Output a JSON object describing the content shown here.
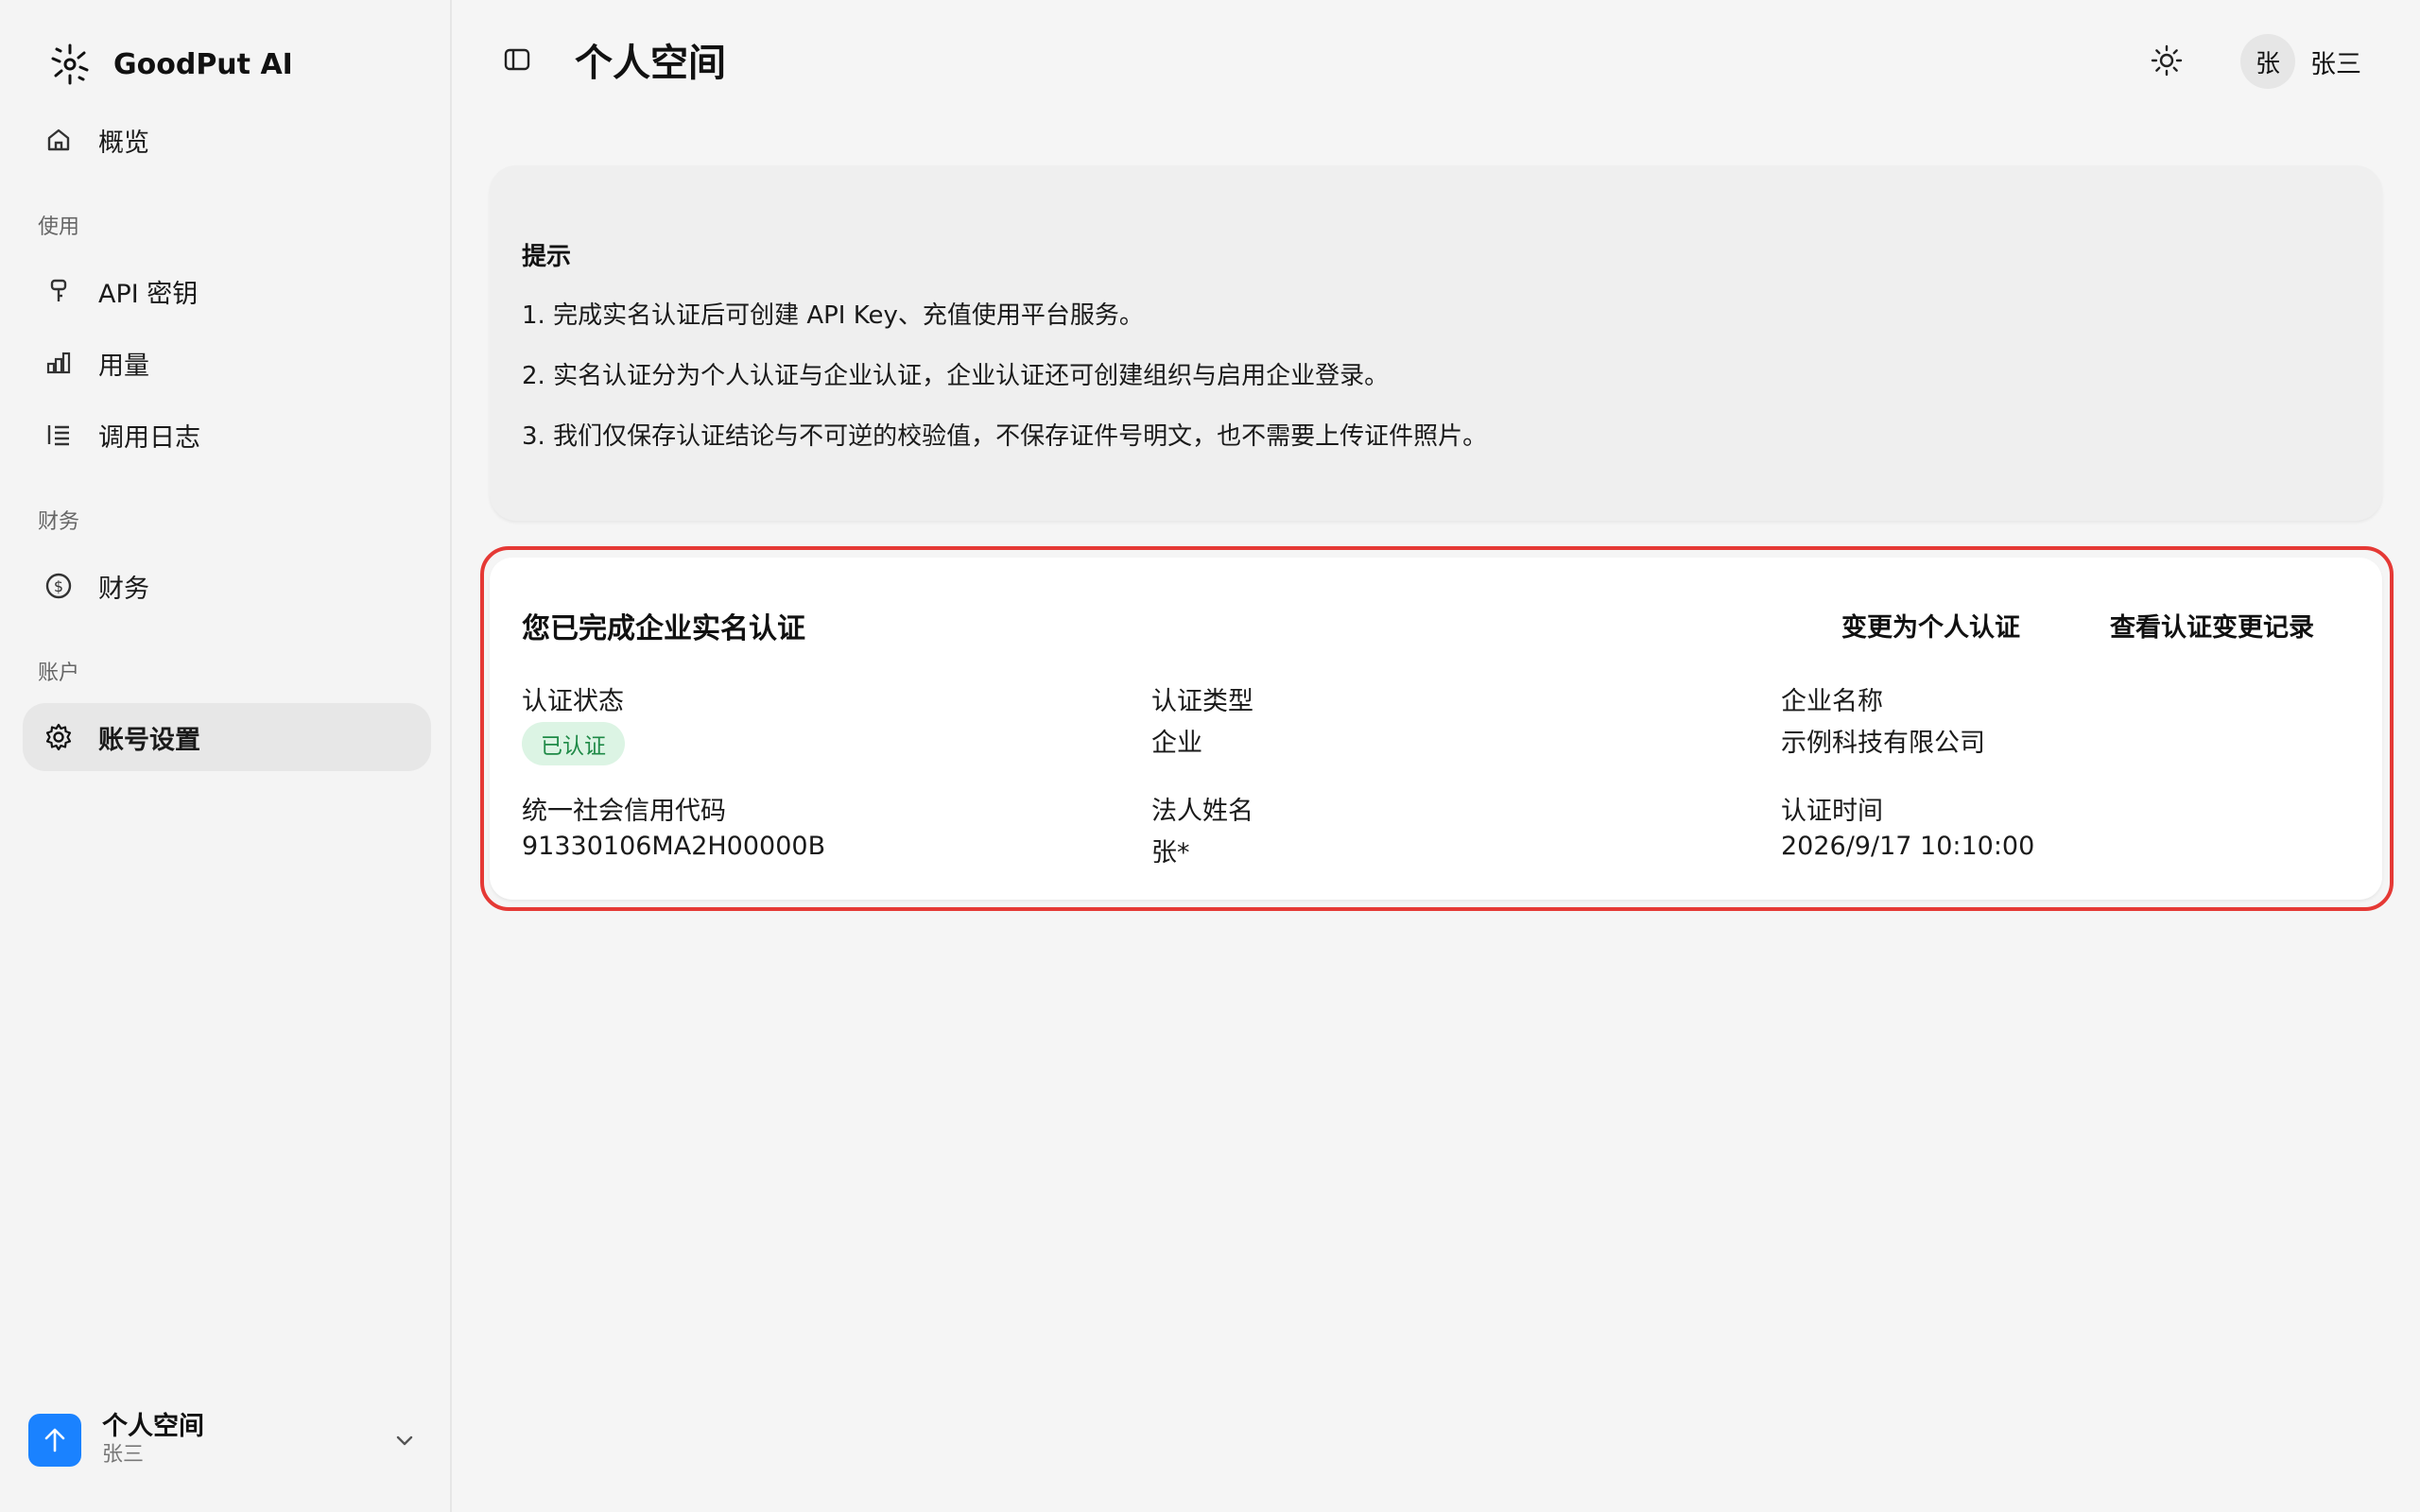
{
  "brand": {
    "name": "GoodPut AI",
    "logo_icon": "goodput-logo-icon"
  },
  "sidebar": {
    "items": [
      {
        "label": "概览",
        "icon": "home-icon"
      },
      {
        "label": "API 密钥",
        "icon": "key-icon"
      },
      {
        "label": "用量",
        "icon": "bar-chart-icon"
      },
      {
        "label": "调用日志",
        "icon": "list-icon"
      },
      {
        "label": "财务",
        "icon": "dollar-circle-icon"
      },
      {
        "label": "账号设置",
        "icon": "gear-icon"
      }
    ],
    "sections": {
      "usage": "使用",
      "finance": "财务",
      "account": "账户"
    },
    "active_item": "账号设置"
  },
  "workspace": {
    "name": "个人空间",
    "user": "张三"
  },
  "header": {
    "title": "个人空间",
    "user_avatar_initial": "张",
    "user_name": "张三"
  },
  "notice": {
    "title": "提示",
    "lines": [
      "1. 完成实名认证后可创建 API Key、充值使用平台服务。",
      "2. 实名认证分为个人认证与企业认证，企业认证还可创建组织与启用企业登录。",
      "3. 我们仅保存认证结论与不可逆的校验值，不保存证件号明文，也不需要上传证件照片。"
    ]
  },
  "status": {
    "title": "您已完成企业实名认证",
    "switch_link": "变更为个人认证",
    "history_link": "查看认证变更记录",
    "fields": {
      "status_label": "认证状态",
      "status_value": "已认证",
      "type_label": "认证类型",
      "type_value": "企业",
      "company_label": "企业名称",
      "company_value": "示例科技有限公司",
      "credit_code_label": "统一社会信用代码",
      "credit_code_value": "91330106MA2H00000B",
      "legal_rep_label": "法人姓名",
      "legal_rep_value": "张*",
      "time_label": "认证时间",
      "time_value": "2026/9/17 10:10:00"
    }
  },
  "colors": {
    "accent": "#1a82ff",
    "highlight_border": "#e53935",
    "badge_bg": "#dcf4e4",
    "badge_text": "#1f8a47"
  }
}
